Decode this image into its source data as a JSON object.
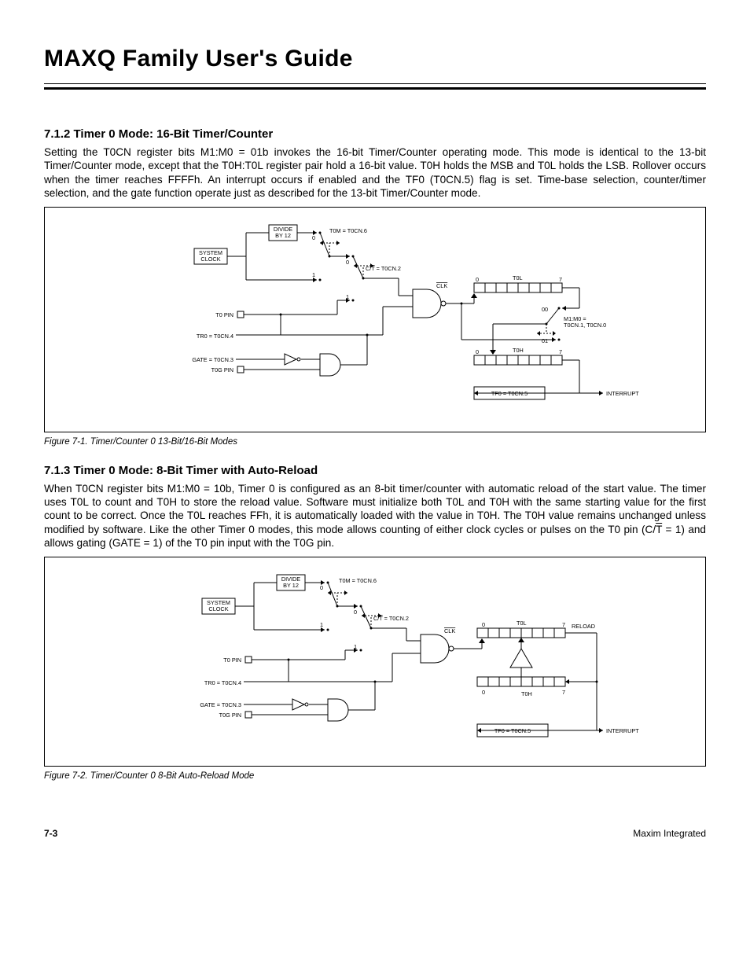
{
  "header": {
    "title": "MAXQ Family User's Guide"
  },
  "s1": {
    "heading": "7.1.2 Timer 0 Mode: 16-Bit Timer/Counter",
    "para": "Setting the T0CN register bits M1:M0 = 01b invokes the 16-bit Timer/Counter operating mode. This mode is identical to the 13-bit Timer/Counter mode, except that the T0H:T0L register pair hold a 16-bit value. T0H holds the MSB and T0L holds the LSB. Rollover occurs when the timer reaches FFFFh. An interrupt occurs if enabled and the TF0 (T0CN.5) flag is set. Time-base selection, counter/timer selection, and the gate function operate just as described for the 13-bit Timer/Counter mode."
  },
  "fig1": {
    "caption": "Figure 7-1. Timer/Counter 0 13-Bit/16-Bit Modes",
    "divide": "DIVIDE BY 12",
    "sysclock": "SYSTEM CLOCK",
    "t0m": "T0M = T0CN.6",
    "ct": "C/T = T0CN.2",
    "ct_prefix": "C/",
    "ct_tbar": "T",
    "ct_suffix": " = T0CN.2",
    "clk": "CLK",
    "t0l": "T0L",
    "m1m0_a": "M1:M0 =",
    "m1m0_b": "T0CN.1, T0CN.0",
    "mode00": "00",
    "mode01": "01",
    "t0h": "T0H",
    "t0pin": "T0 PIN",
    "tr0": "TR0 = T0CN.4",
    "gate": "GATE = T0CN.3",
    "t0gpin": "T0G PIN",
    "tf0": "TF0 = T0CN.5",
    "interrupt": "INTERRUPT",
    "n0": "0",
    "n1": "1",
    "n7": "7"
  },
  "s2": {
    "heading": "7.1.3 Timer 0 Mode: 8-Bit Timer with Auto-Reload",
    "para_a": "When T0CN register bits M1:M0 = 10b, Timer 0 is configured as an 8-bit timer/counter with automatic reload of the start value. The timer uses T0L to count and T0H to store the reload value. Software must initialize both T0L and T0H with the same starting value for the first count to be correct. Once the T0L reaches FFh, it is automatically loaded with the value in T0H. The T0H value remains unchanged unless modified by software. Like the other Timer 0 modes, this mode allows counting of either clock cycles or pulses on the T0 pin (C/",
    "tbar": "T",
    "para_b": " = 1) and allows gating (GATE = 1) of the T0 pin input with the T0G pin."
  },
  "fig2": {
    "caption": "Figure 7-2. Timer/Counter 0 8-Bit Auto-Reload Mode",
    "reload": "RELOAD"
  },
  "footer": {
    "left": "7-3",
    "right": "Maxim Integrated"
  }
}
